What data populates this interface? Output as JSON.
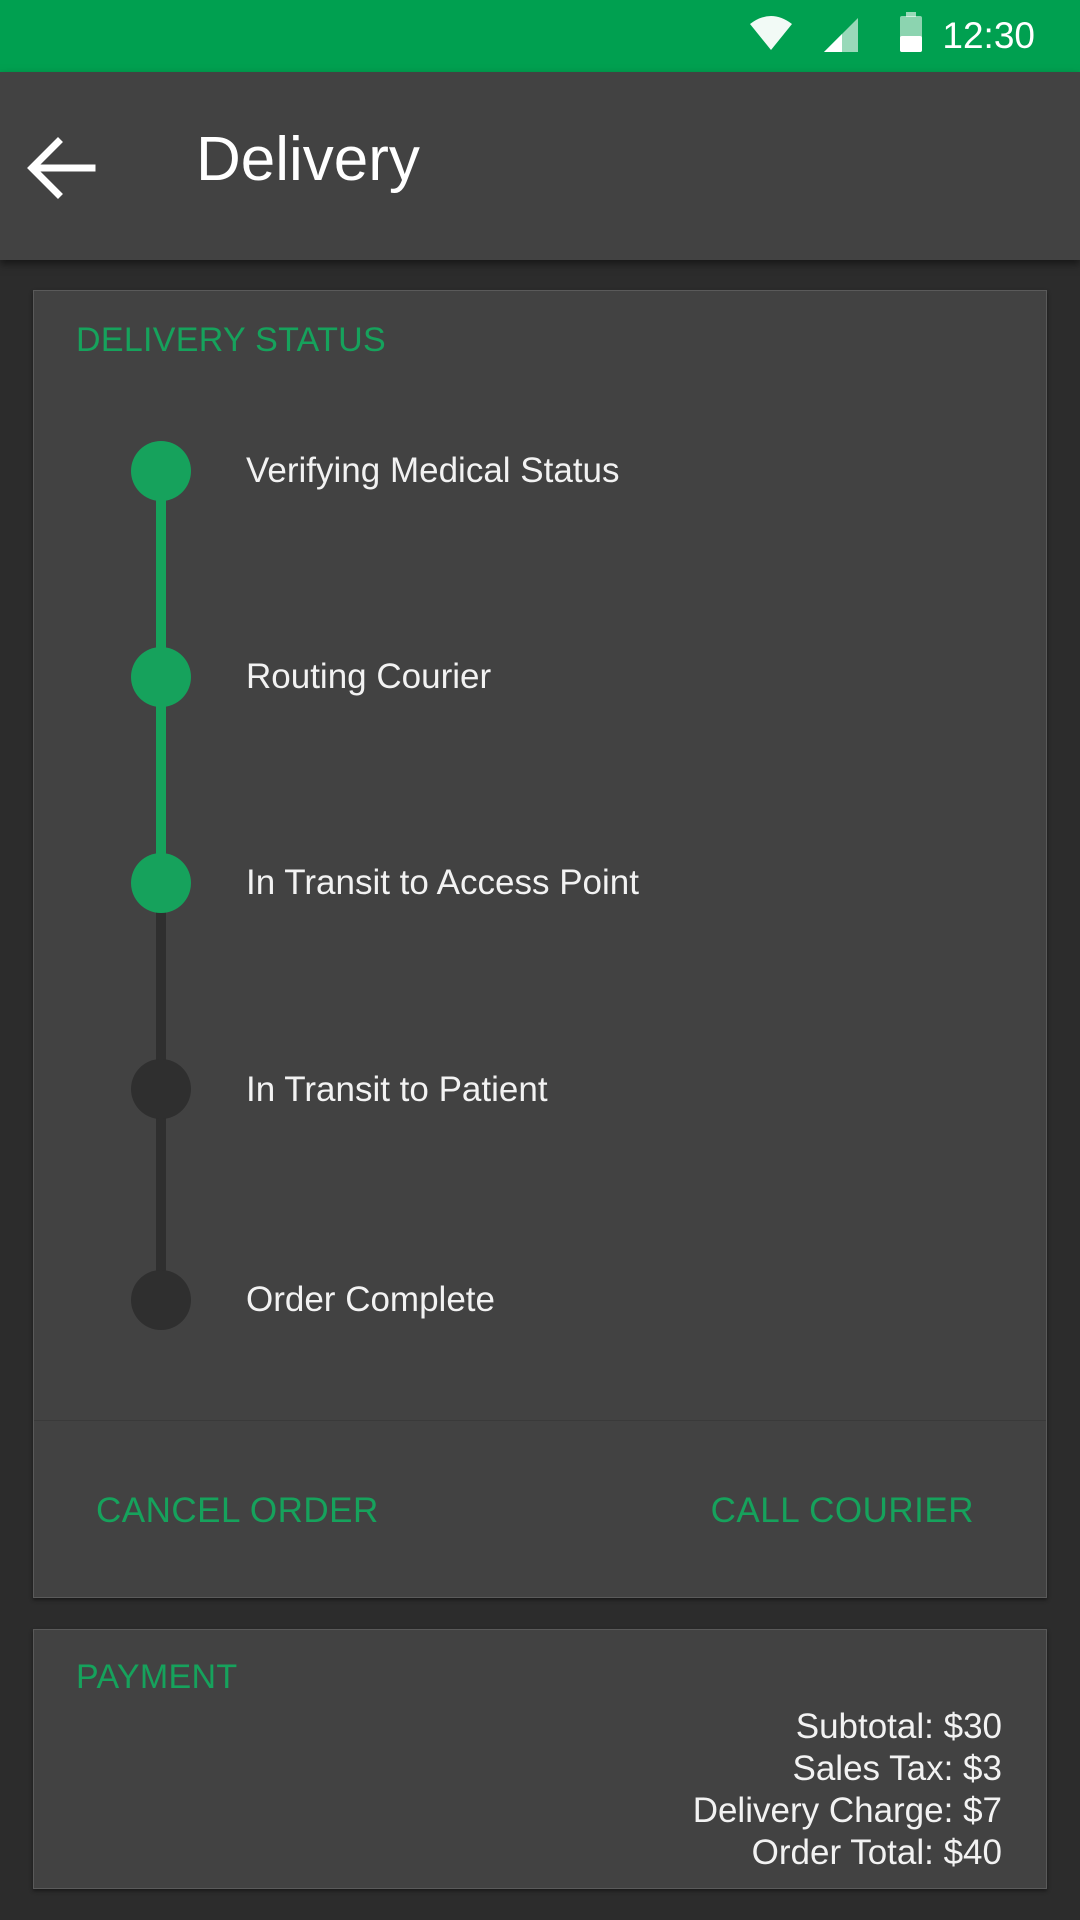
{
  "status_bar": {
    "time": "12:30",
    "icons": [
      "wifi-icon",
      "cell-signal-icon",
      "battery-icon"
    ],
    "color": "#00a050"
  },
  "app_bar": {
    "title": "Delivery",
    "back_icon": "arrow-left-icon"
  },
  "delivery_status": {
    "heading": "DELIVERY STATUS",
    "steps": [
      {
        "label": "Verifying Medical Status",
        "complete": true
      },
      {
        "label": "Routing Courier",
        "complete": true
      },
      {
        "label": "In Transit to Access Point",
        "complete": true
      },
      {
        "label": "In Transit to Patient",
        "complete": false
      },
      {
        "label": "Order Complete",
        "complete": false
      }
    ],
    "actions": {
      "cancel_label": "CANCEL ORDER",
      "call_label": "CALL COURIER"
    }
  },
  "payment": {
    "heading": "PAYMENT",
    "lines": [
      {
        "text": "Subtotal: $30"
      },
      {
        "text": "Sales Tax: $3"
      },
      {
        "text": "Delivery Charge: $7"
      },
      {
        "text": "Order Total: $40"
      }
    ]
  },
  "colors": {
    "accent": "#16a25c",
    "incomplete": "#2f2f2f",
    "card": "#424242",
    "background": "#2c2c2c"
  }
}
